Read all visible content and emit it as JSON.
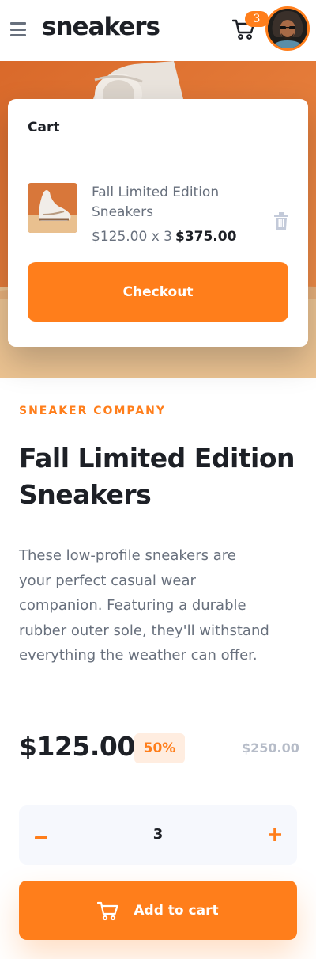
{
  "header": {
    "logo": "sneakers",
    "cart_count": "3"
  },
  "cart": {
    "title": "Cart",
    "item": {
      "name": "Fall Limited Edition Sneakers",
      "unit_price_qty": "$125.00 x 3",
      "total": "$375.00"
    },
    "checkout_label": "Checkout"
  },
  "product": {
    "company": "SNEAKER COMPANY",
    "title": "Fall Limited Edition Sneakers",
    "description": "These low-profile sneakers are your perfect casual wear companion. Featuring a durable rubber outer sole, they'll withstand everything the weather can offer.",
    "price": "$125.00",
    "discount": "50%",
    "original_price": "$250.00"
  },
  "quantity": {
    "value": "3",
    "minus": "–",
    "plus": "+"
  },
  "add_to_cart_label": "Add to cart",
  "colors": {
    "accent": "#ff7e1b",
    "accent_pale": "#ffede0",
    "dark_text": "#1d2026",
    "muted_text": "#68707d",
    "strike_text": "#b6bcc8",
    "light_bg": "#f6f8fd"
  },
  "icons": [
    "menu-icon",
    "cart-icon",
    "avatar",
    "trash-icon",
    "plus-icon",
    "minus-icon"
  ]
}
